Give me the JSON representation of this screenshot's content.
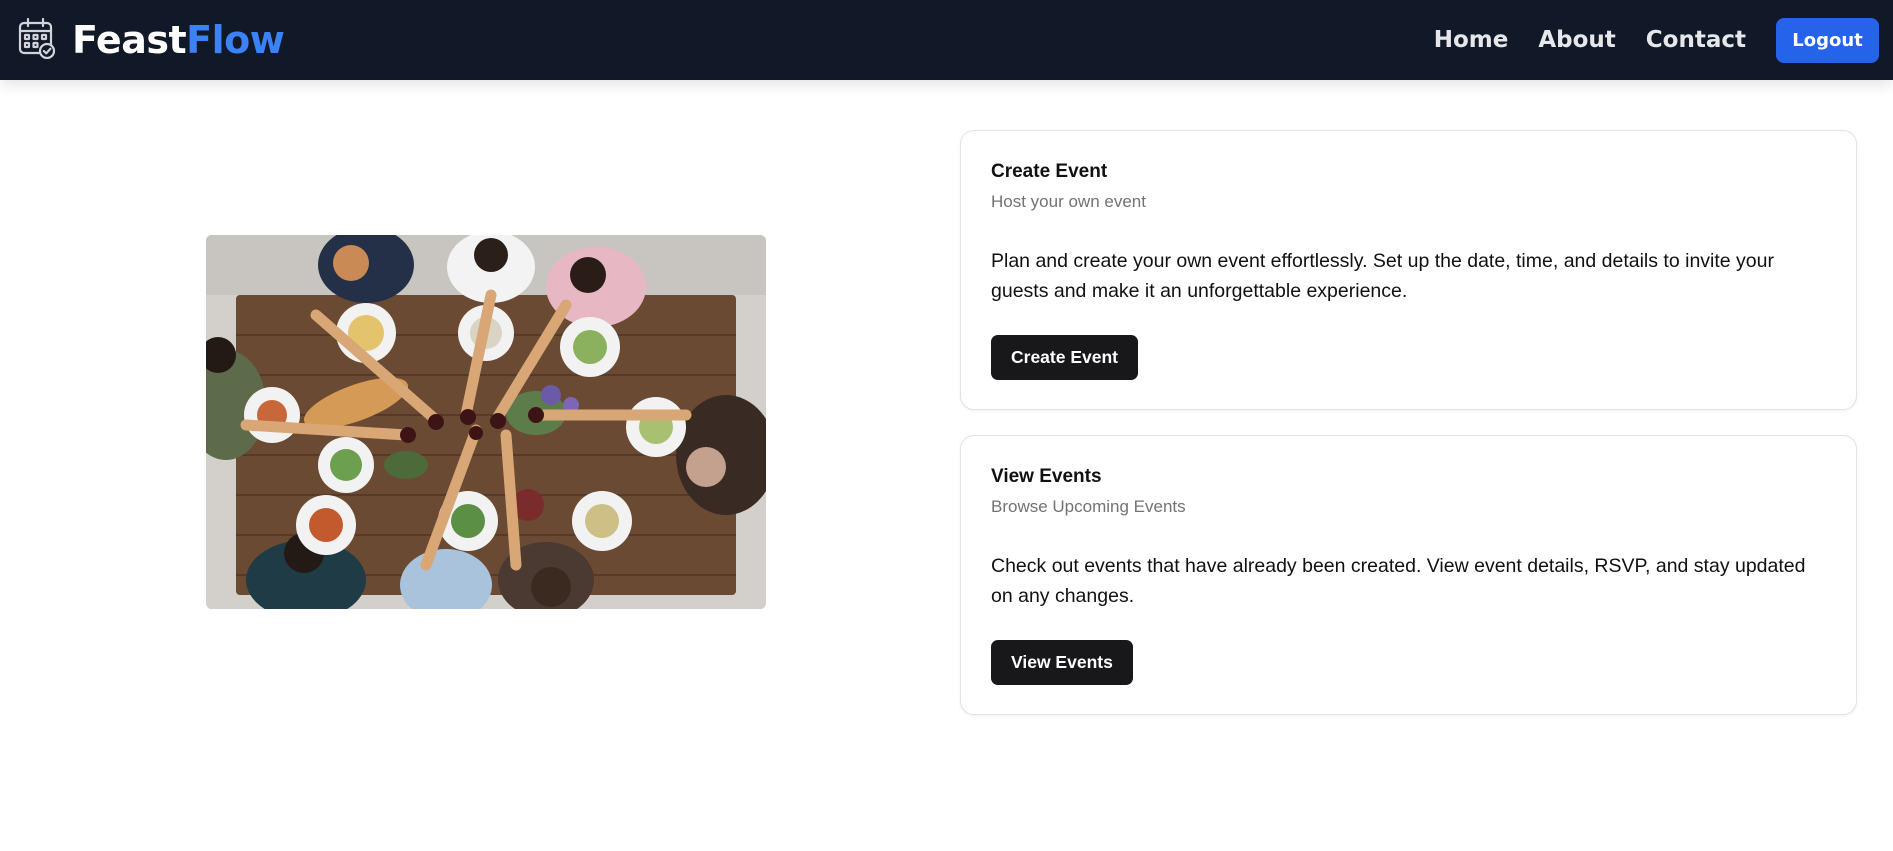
{
  "brand": {
    "name_part1": "Feast",
    "name_part2": "Flow",
    "accent_color": "#3b82f6",
    "icon": "calendar-check-icon"
  },
  "nav": {
    "links": [
      "Home",
      "About",
      "Contact"
    ],
    "logout_label": "Logout",
    "background": "#111827",
    "button_color": "#2563eb"
  },
  "hero": {
    "image": "people-toasting-at-dinner-table-photo"
  },
  "cards": [
    {
      "title": "Create Event",
      "subtitle": "Host your own event",
      "description": "Plan and create your own event effortlessly. Set up the date, time, and details to invite your guests and make it an unforgettable experience.",
      "button_label": "Create Event"
    },
    {
      "title": "View Events",
      "subtitle": "Browse Upcoming Events",
      "description": "Check out events that have already been created. View event details, RSVP, and stay updated on any changes.",
      "button_label": "View Events"
    }
  ]
}
